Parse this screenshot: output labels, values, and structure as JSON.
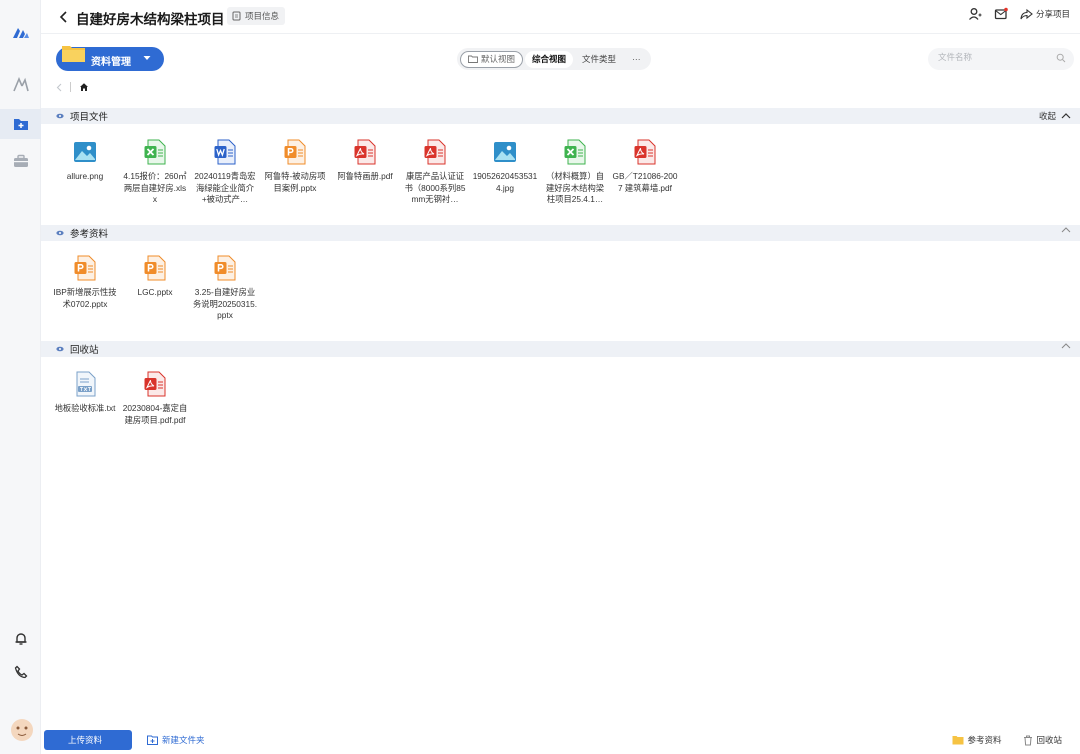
{
  "header": {
    "title": "自建好房木结构梁柱项目",
    "info_label": "项目信息",
    "share_label": "分享项目"
  },
  "toolbar": {
    "dropdown_label": "资料管理",
    "view_tabs": [
      {
        "label": "默认视图"
      },
      {
        "label": "综合视图"
      },
      {
        "label": "文件类型"
      },
      {
        "label": "···"
      }
    ],
    "search_placeholder": "文件名称"
  },
  "sections": [
    {
      "title": "项目文件",
      "collapse_label": "收起",
      "files": [
        {
          "name": "allure.png",
          "type": "image"
        },
        {
          "name": "4.15报价：260㎡两层自建好房.xlsx",
          "type": "excel"
        },
        {
          "name": "20240119青岛宏海绿能企业简介+被动式产…",
          "type": "word"
        },
        {
          "name": "阿鲁特-被动房项目案例.pptx",
          "type": "ppt"
        },
        {
          "name": "阿鲁特画册.pdf",
          "type": "pdf"
        },
        {
          "name": "康居产品认证证书（8000系列85mm无钢衬…",
          "type": "pdf"
        },
        {
          "name": "190526204535314.jpg",
          "type": "image"
        },
        {
          "name": "（材料概算）自建好房木结构梁柱项目25.4.1…",
          "type": "excel"
        },
        {
          "name": "GB／T21086-2007 建筑幕墙.pdf",
          "type": "pdf"
        }
      ]
    },
    {
      "title": "参考资料",
      "collapse_label": "",
      "files": [
        {
          "name": "IBP新增展示性技术0702.pptx",
          "type": "ppt"
        },
        {
          "name": "LGC.pptx",
          "type": "ppt"
        },
        {
          "name": "3.25-自建好房业务说明20250315.pptx",
          "type": "ppt"
        }
      ]
    },
    {
      "title": "回收站",
      "collapse_label": "",
      "files": [
        {
          "name": "地板验收标准.txt",
          "type": "txt"
        },
        {
          "name": "20230804-嘉定自建房项目.pdf.pdf",
          "type": "pdf"
        }
      ]
    }
  ],
  "footer": {
    "upload_label": "上传资料",
    "new_folder_label": "新建文件夹",
    "reference_label": "参考资料",
    "recycle_label": "回收站"
  },
  "colors": {
    "accent": "#2f6bd3",
    "section_bg": "#eef1f6",
    "pdf": "#d9342b",
    "ppt": "#f08c2a",
    "excel": "#3fb34f",
    "word": "#2c62c9",
    "image": "#3ba5c9"
  }
}
